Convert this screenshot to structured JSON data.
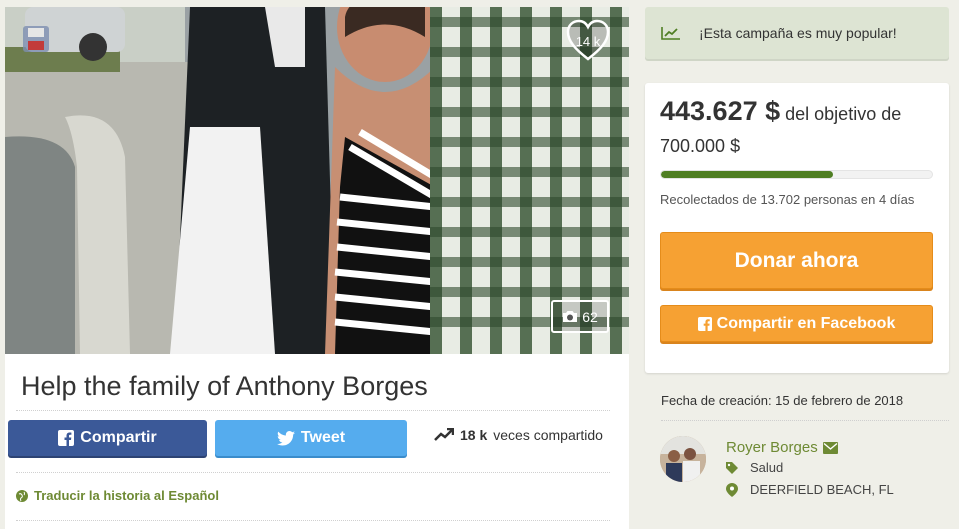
{
  "hero": {
    "heart_count": "14 k",
    "photo_count": "62"
  },
  "campaign": {
    "title": "Help the family of Anthony Borges"
  },
  "share_bar": {
    "facebook_label": "Compartir",
    "tweet_label": "Tweet",
    "share_count": "18 k",
    "share_suffix": "veces compartido"
  },
  "translate_label": "Traducir la historia al Español",
  "popular_banner": "¡Esta campaña es muy popular!",
  "donation": {
    "raised": "443.627 $",
    "goal_text": "del objetivo de 700.000 $",
    "progress_fraction": 0.634,
    "collected_text": "Recolectados de 13.702 personas en 4 días",
    "donate_label": "Donar ahora",
    "facebook_share_label": "Compartir en Facebook"
  },
  "created_text": "Fecha de creación: 15 de febrero de 2018",
  "organizer": {
    "name": "Royer Borges",
    "category": "Salud",
    "location": "DEERFIELD BEACH, FL"
  },
  "colors": {
    "accent_green": "#6e8a34",
    "progress_green": "#4f7e23",
    "donate_orange": "#f6a133",
    "facebook_blue": "#3b5998",
    "twitter_blue": "#55acee"
  },
  "icons": [
    "heart-icon",
    "camera-icon",
    "save-icon",
    "facebook-icon",
    "twitter-icon",
    "trending-icon",
    "globe-icon",
    "envelope-icon",
    "tag-icon",
    "location-pin-icon"
  ]
}
